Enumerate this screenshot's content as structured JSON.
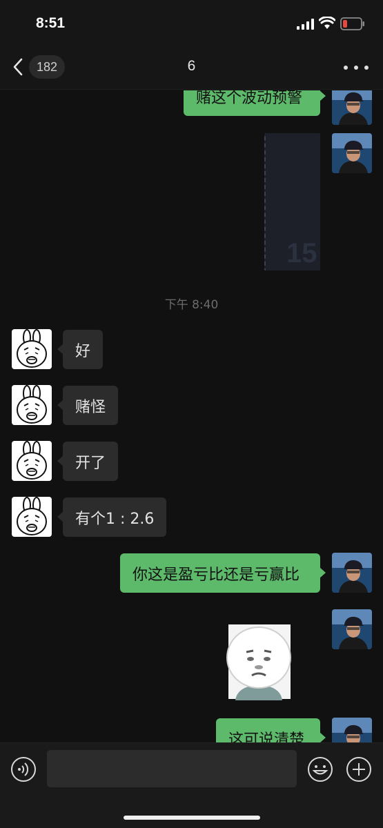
{
  "status_bar": {
    "time": "8:51",
    "icons": [
      "signal-icon",
      "wifi-icon",
      "battery-low-icon"
    ],
    "battery_color": "#e5483f"
  },
  "nav": {
    "back_icon": "chevron-left-icon",
    "unread_count": "182",
    "title": "6",
    "more_icon": "ellipsis-icon"
  },
  "messages": [
    {
      "sender": "me",
      "type": "text",
      "text": "赌这个波动预警"
    },
    {
      "sender": "me",
      "type": "image",
      "text": "15"
    },
    {
      "type": "timestamp",
      "text": "下午 8:40"
    },
    {
      "sender": "other",
      "type": "text",
      "text": "好"
    },
    {
      "sender": "other",
      "type": "text",
      "text": "赌怪"
    },
    {
      "sender": "other",
      "type": "text",
      "text": "开了"
    },
    {
      "sender": "other",
      "type": "text",
      "text": "有个1 : 2.6"
    },
    {
      "sender": "me",
      "type": "text",
      "text": "你这是盈亏比还是亏赢比"
    },
    {
      "sender": "me",
      "type": "sticker"
    },
    {
      "sender": "me",
      "type": "text",
      "text": "这可说清楚"
    }
  ],
  "input_bar": {
    "voice_icon": "voice-icon",
    "input_value": "",
    "emoji_icon": "emoji-icon",
    "plus_icon": "plus-icon"
  },
  "colors": {
    "outgoing_bubble": "#5dba6a",
    "incoming_bubble": "#2c2c2c",
    "background": "#111111"
  }
}
